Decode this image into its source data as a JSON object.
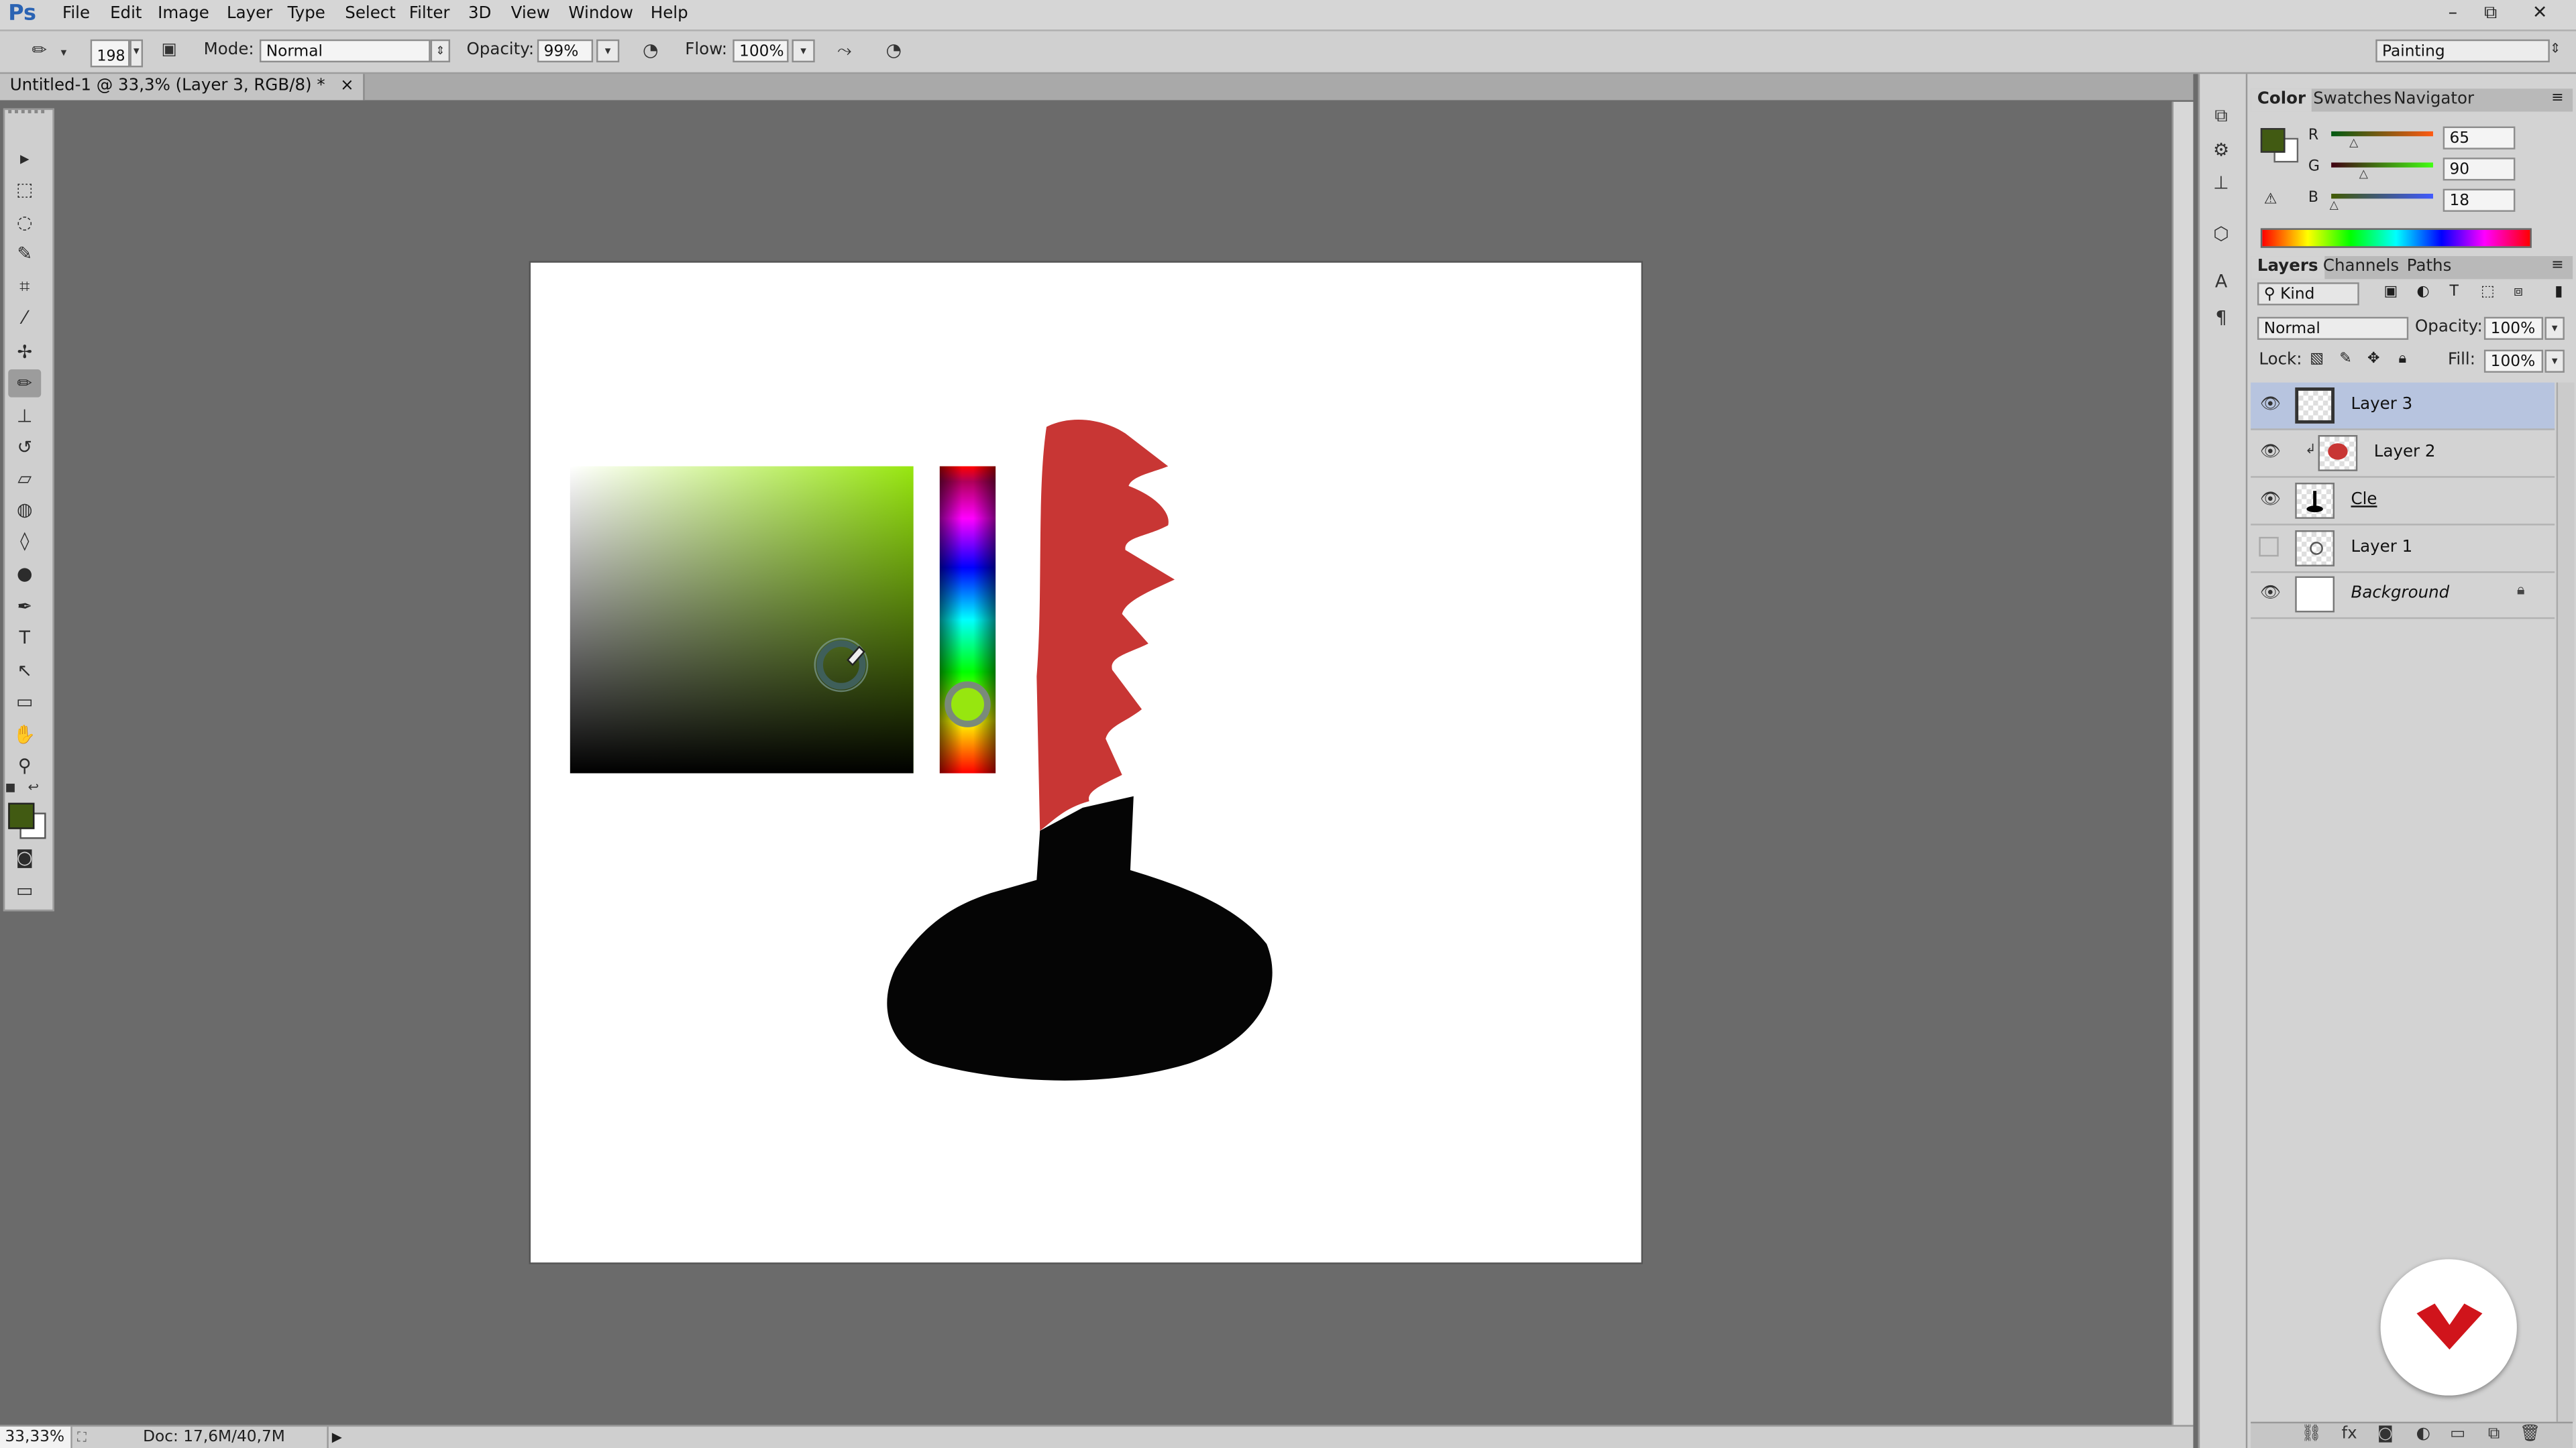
{
  "app": {
    "logo": "Ps"
  },
  "menu": [
    "File",
    "Edit",
    "Image",
    "Layer",
    "Type",
    "Select",
    "Filter",
    "3D",
    "View",
    "Window",
    "Help"
  ],
  "window_controls": {
    "minimize": "–",
    "restore": "⧉",
    "close": "✕"
  },
  "options_bar": {
    "brush_size": "198",
    "mode_label": "Mode:",
    "mode_value": "Normal",
    "opacity_label": "Opacity:",
    "opacity_value": "99%",
    "flow_label": "Flow:",
    "flow_value": "100%",
    "workspace": "Painting"
  },
  "document": {
    "tab_title": "Untitled-1 @ 33,3% (Layer 3, RGB/8) *",
    "tab_close": "×"
  },
  "status": {
    "zoom": "33,33%",
    "doc_size": "Doc: 17,6M/40,7M",
    "arrow": "▶"
  },
  "tools": [
    {
      "name": "move-tool-icon",
      "glyph": "▸"
    },
    {
      "name": "marquee-tool-icon",
      "glyph": "⬚"
    },
    {
      "name": "lasso-tool-icon",
      "glyph": "◌"
    },
    {
      "name": "quick-select-tool-icon",
      "glyph": "✎"
    },
    {
      "name": "crop-tool-icon",
      "glyph": "⌗"
    },
    {
      "name": "eyedropper-tool-icon",
      "glyph": "⁄"
    },
    {
      "name": "healing-tool-icon",
      "glyph": "✢"
    },
    {
      "name": "brush-tool-icon",
      "glyph": "✏"
    },
    {
      "name": "stamp-tool-icon",
      "glyph": "⊥"
    },
    {
      "name": "history-brush-tool-icon",
      "glyph": "↺"
    },
    {
      "name": "eraser-tool-icon",
      "glyph": "▱"
    },
    {
      "name": "paint-bucket-tool-icon",
      "glyph": "◍"
    },
    {
      "name": "blur-tool-icon",
      "glyph": "◊"
    },
    {
      "name": "dodge-tool-icon",
      "glyph": "●"
    },
    {
      "name": "pen-tool-icon",
      "glyph": "✒"
    },
    {
      "name": "type-tool-icon",
      "glyph": "T"
    },
    {
      "name": "path-select-tool-icon",
      "glyph": "↖"
    },
    {
      "name": "shape-tool-icon",
      "glyph": "▭"
    },
    {
      "name": "hand-tool-icon",
      "glyph": "✋"
    },
    {
      "name": "zoom-tool-icon",
      "glyph": "⚲"
    }
  ],
  "colors": {
    "foreground": "#415a12",
    "background": "#ffffff",
    "red_shape": "#c83634",
    "black_shape": "#050505",
    "selected_hue": "#97e60f",
    "brand_red": "#d0141b"
  },
  "color_panel": {
    "tabs": [
      "Color",
      "Swatches",
      "Navigator"
    ],
    "channels": [
      {
        "label": "R",
        "value": "65"
      },
      {
        "label": "G",
        "value": "90"
      },
      {
        "label": "B",
        "value": "18"
      }
    ]
  },
  "layers_panel": {
    "tabs": [
      "Layers",
      "Channels",
      "Paths"
    ],
    "filter": "Kind",
    "blend_mode": "Normal",
    "opacity_label": "Opacity:",
    "opacity_value": "100%",
    "lock_label": "Lock:",
    "fill_label": "Fill:",
    "fill_value": "100%",
    "layers": [
      {
        "name": "Layer 3",
        "visible": true,
        "selected": true
      },
      {
        "name": "Layer 2",
        "visible": true,
        "selected": false
      },
      {
        "name": "Cle",
        "visible": true,
        "selected": false
      },
      {
        "name": "Layer 1",
        "visible": false,
        "selected": false
      },
      {
        "name": "Background",
        "visible": true,
        "selected": false
      }
    ]
  }
}
